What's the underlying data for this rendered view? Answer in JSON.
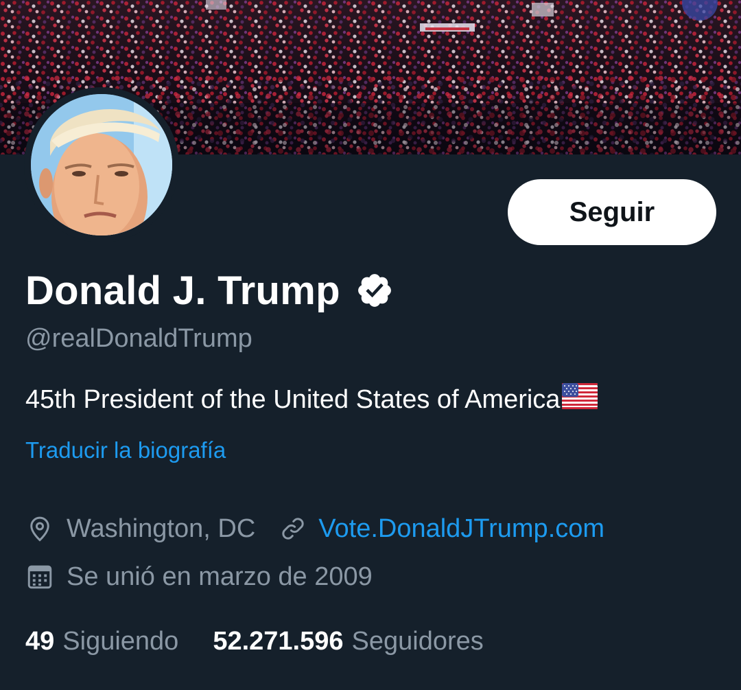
{
  "profile": {
    "display_name": "Donald J. Trump",
    "handle": "@realDonaldTrump",
    "verified": true,
    "bio": "45th President of the United States of America",
    "bio_emoji": "us-flag",
    "translate_bio_label": "Traducir la biografía",
    "follow_button_label": "Seguir",
    "location": "Washington, DC",
    "website": "Vote.DonaldJTrump.com",
    "joined": "Se unió en marzo de 2009"
  },
  "stats": {
    "following_count": "49",
    "following_label": "Siguiendo",
    "followers_count": "52.271.596",
    "followers_label": "Seguidores"
  },
  "icons": {
    "verified": "verified-badge-icon",
    "location": "location-pin-icon",
    "link": "link-icon",
    "calendar": "calendar-icon"
  },
  "colors": {
    "background": "#15202b",
    "text_primary": "#ffffff",
    "text_secondary": "#8b98a5",
    "accent": "#1d9bf0",
    "button_bg": "#ffffff",
    "button_text": "#0f1419"
  }
}
